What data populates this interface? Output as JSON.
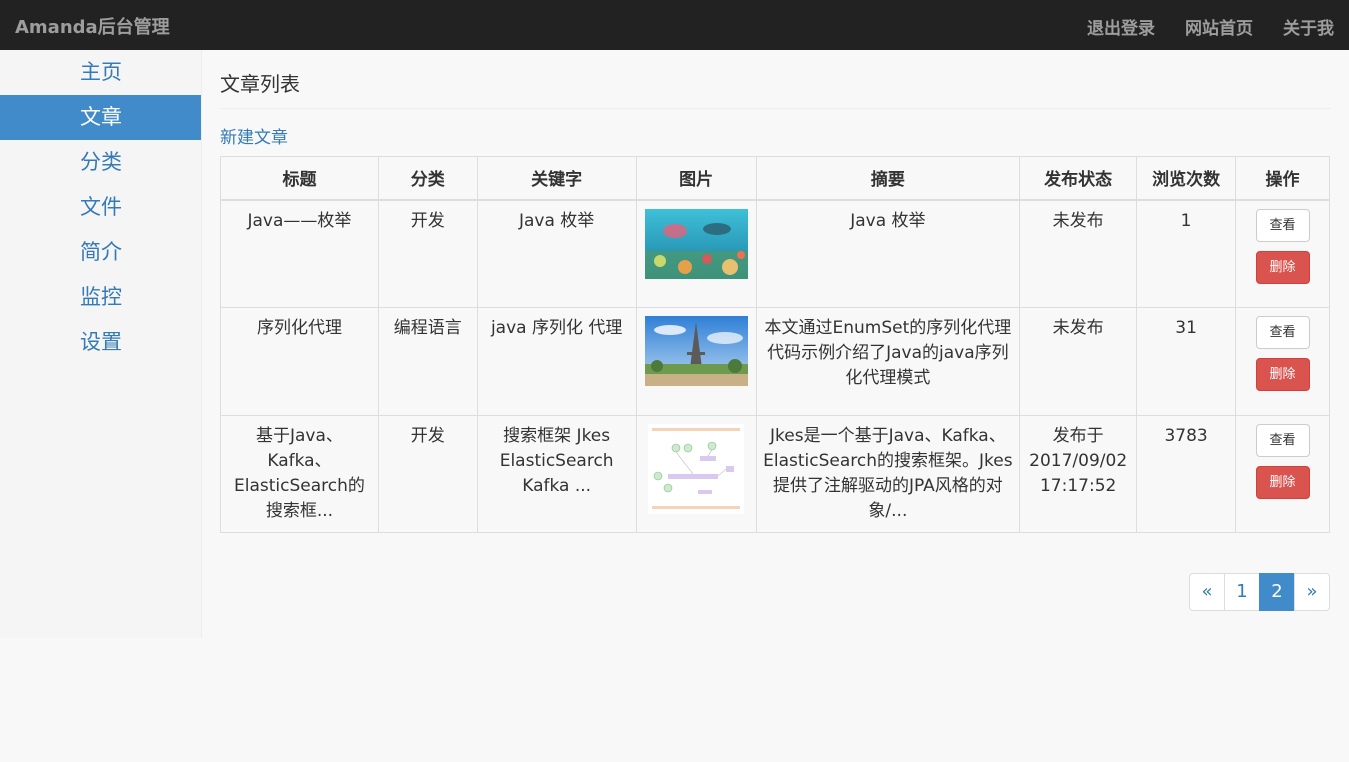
{
  "navbar": {
    "brand": "Amanda后台管理",
    "links": [
      "退出登录",
      "网站首页",
      "关于我"
    ]
  },
  "sidebar": {
    "items": [
      {
        "label": "主页",
        "active": false
      },
      {
        "label": "文章",
        "active": true
      },
      {
        "label": "分类",
        "active": false
      },
      {
        "label": "文件",
        "active": false
      },
      {
        "label": "简介",
        "active": false
      },
      {
        "label": "监控",
        "active": false
      },
      {
        "label": "设置",
        "active": false
      }
    ]
  },
  "main": {
    "title": "文章列表",
    "new_link": "新建文章"
  },
  "table": {
    "headers": [
      "标题",
      "分类",
      "关键字",
      "图片",
      "摘要",
      "发布状态",
      "浏览次数",
      "操作"
    ],
    "rows": [
      {
        "title": "Java——枚举",
        "category": "开发",
        "keywords": "Java 枚举",
        "image": "underwater-coral-thumbnail",
        "summary": "Java 枚举",
        "status": "未发布",
        "views": "1",
        "view_btn": "查看",
        "delete_btn": "删除"
      },
      {
        "title": "序列化代理",
        "category": "编程语言",
        "keywords": "java 序列化 代理",
        "image": "eiffel-tower-thumbnail",
        "summary": "本文通过EnumSet的序列化代理代码示例介绍了Java的java序列化代理模式",
        "status": "未发布",
        "views": "31",
        "view_btn": "查看",
        "delete_btn": "删除"
      },
      {
        "title": "基于Java、Kafka、ElasticSearch的搜索框...",
        "category": "开发",
        "keywords": "搜索框架 Jkes ElasticSearch Kafka ...",
        "image": "architecture-diagram-thumbnail",
        "summary": "Jkes是一个基于Java、Kafka、ElasticSearch的搜索框架。Jkes提供了注解驱动的JPA风格的对象/...",
        "status": "发布于 2017/09/02 17:17:52",
        "views": "3783",
        "view_btn": "查看",
        "delete_btn": "删除"
      }
    ]
  },
  "pagination": {
    "prev": "«",
    "pages": [
      "1",
      "2"
    ],
    "current": "2",
    "next": "»"
  },
  "colors": {
    "navbar_bg": "#222222",
    "accent": "#428bca",
    "link": "#337ab7",
    "danger": "#d9534f"
  }
}
